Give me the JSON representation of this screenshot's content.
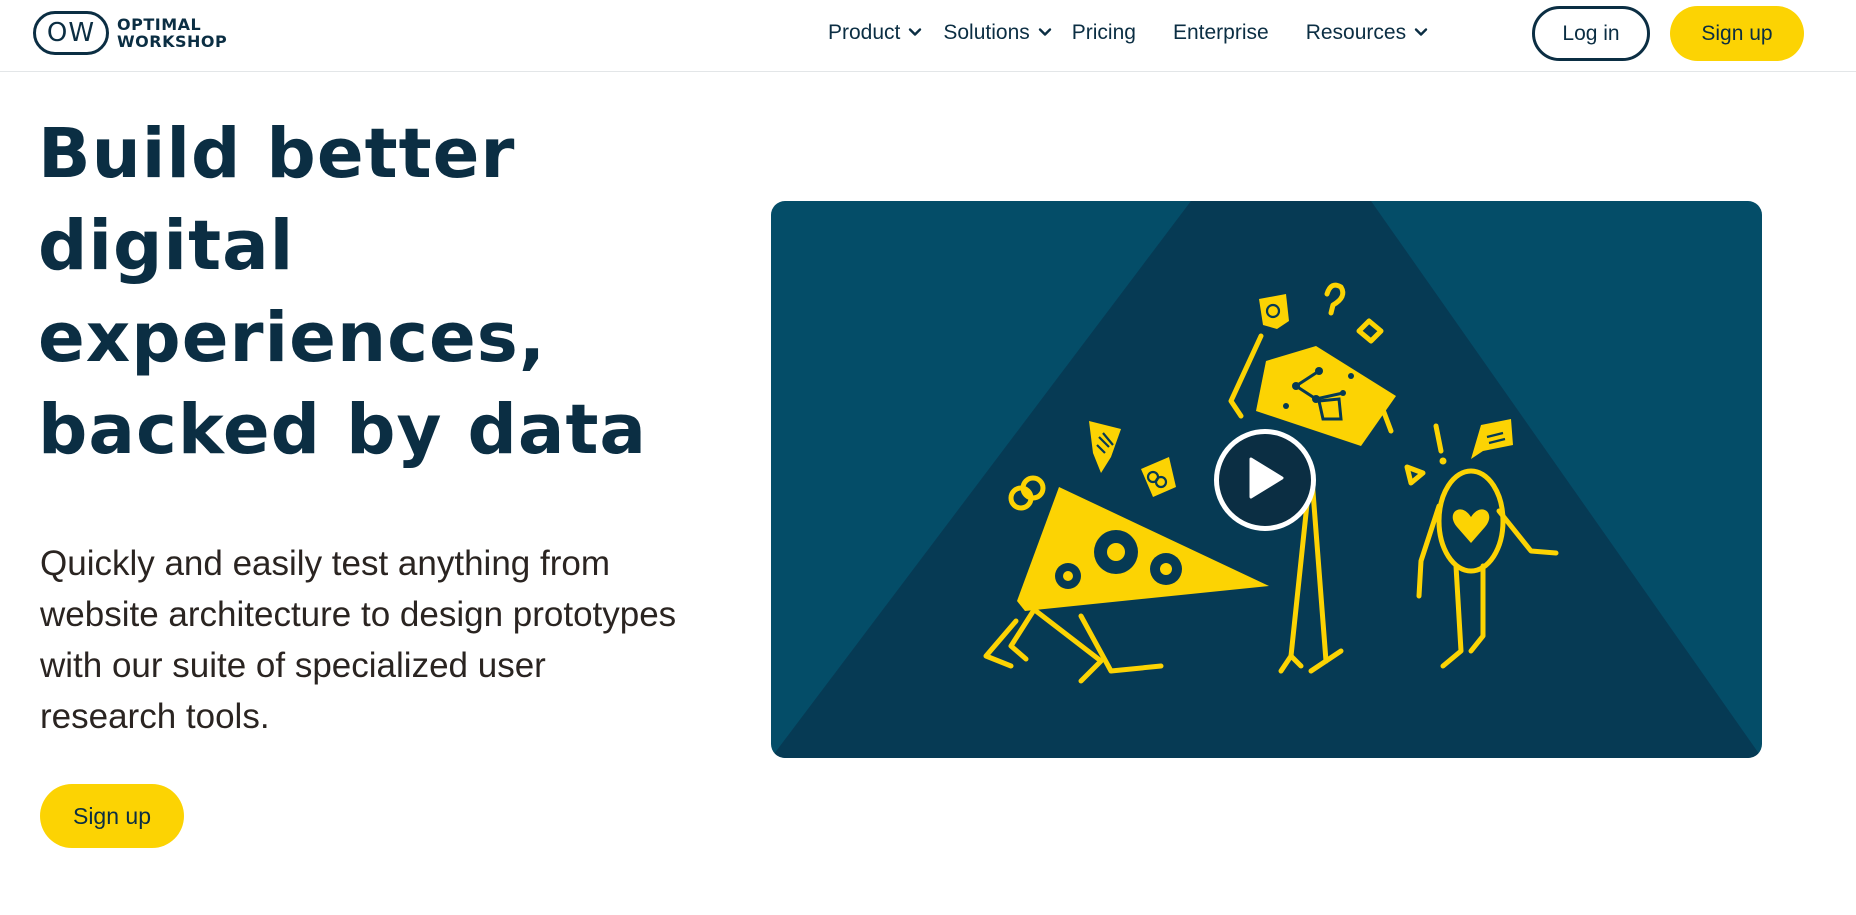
{
  "header": {
    "logo": {
      "mark": "OW",
      "line1": "OPTIMAL",
      "line2": "WORKSHOP"
    },
    "nav": [
      {
        "label": "Product",
        "has_dropdown": true
      },
      {
        "label": "Solutions",
        "has_dropdown": true
      },
      {
        "label": "Pricing",
        "has_dropdown": false
      },
      {
        "label": "Enterprise",
        "has_dropdown": false
      },
      {
        "label": "Resources",
        "has_dropdown": true
      }
    ],
    "login_label": "Log in",
    "signup_label": "Sign up"
  },
  "hero": {
    "title_lines": [
      "Build better",
      "digital",
      "experiences,",
      "backed by data"
    ],
    "subtitle": "Quickly and easily test anything from website architecture to design prototypes with our suite of specialized user research tools.",
    "cta_label": "Sign up"
  },
  "video": {
    "play_icon": "play-icon"
  },
  "colors": {
    "navy": "#0b2e43",
    "brand_yellow": "#fcd303",
    "video_bg": "#044d68",
    "video_triangle": "#063a54"
  }
}
